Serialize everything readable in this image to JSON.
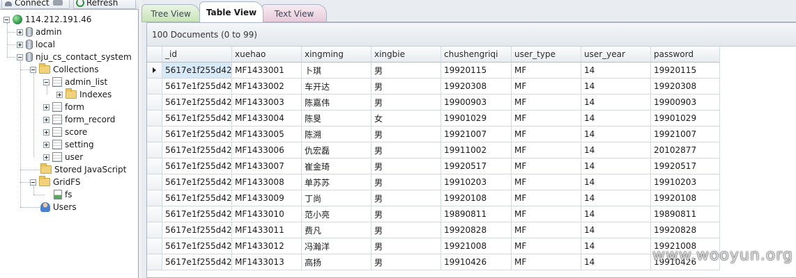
{
  "toolbar": {
    "connect_label": "Connect",
    "refresh_label": "Refresh"
  },
  "tree": {
    "server": "114.212.191.46",
    "databases": [
      "admin",
      "local",
      "nju_cs_contact_system"
    ],
    "collections_label": "Collections",
    "collections": [
      "admin_list",
      "form",
      "form_record",
      "score",
      "setting",
      "user"
    ],
    "indexes_label": "Indexes",
    "stored_js_label": "Stored JavaScript",
    "gridfs_label": "GridFS",
    "gridfs_items": [
      "fs"
    ],
    "users_label": "Users"
  },
  "tabs": [
    "Tree View",
    "Table View",
    "Text View"
  ],
  "active_tab": "Table View",
  "documents_count": "100 Documents (0 to 99)",
  "table": {
    "columns": [
      "_id",
      "xuehao",
      "xingming",
      "xingbie",
      "chushengriqi",
      "user_type",
      "user_year",
      "password"
    ],
    "rows": [
      [
        "5617e1f255d42...",
        "MF1433001",
        "卜琪",
        "男",
        "19920115",
        "MF",
        "14",
        "19920115"
      ],
      [
        "5617e1f255d42...",
        "MF1433002",
        "车开达",
        "男",
        "19920308",
        "MF",
        "14",
        "19920308"
      ],
      [
        "5617e1f255d42...",
        "MF1433003",
        "陈嘉伟",
        "男",
        "19900903",
        "MF",
        "14",
        "19900903"
      ],
      [
        "5617e1f255d42...",
        "MF1433004",
        "陈旻",
        "女",
        "19901029",
        "MF",
        "14",
        "19901029"
      ],
      [
        "5617e1f255d42...",
        "MF1433005",
        "陈溯",
        "男",
        "19921007",
        "MF",
        "14",
        "19921007"
      ],
      [
        "5617e1f255d42...",
        "MF1433006",
        "仇宏磊",
        "男",
        "19911002",
        "MF",
        "14",
        "20102877"
      ],
      [
        "5617e1f255d42...",
        "MF1433007",
        "崔金琦",
        "男",
        "19920517",
        "MF",
        "14",
        "19920517"
      ],
      [
        "5617e1f255d42...",
        "MF1433008",
        "单苏苏",
        "男",
        "19910203",
        "MF",
        "14",
        "19910203"
      ],
      [
        "5617e1f255d42...",
        "MF1433009",
        "丁尚",
        "男",
        "19920108",
        "MF",
        "14",
        "19920108"
      ],
      [
        "5617e1f255d42...",
        "MF1433010",
        "范小亮",
        "男",
        "19890811",
        "MF",
        "14",
        "19890811"
      ],
      [
        "5617e1f255d42...",
        "MF1433011",
        "费凡",
        "男",
        "19920828",
        "MF",
        "14",
        "19920828"
      ],
      [
        "5617e1f255d42...",
        "MF1433012",
        "冯瀚洋",
        "男",
        "19921008",
        "MF",
        "14",
        "19921008"
      ],
      [
        "5617e1f255d42...",
        "MF1433013",
        "高扬",
        "男",
        "19910426",
        "MF",
        "14",
        "19910426"
      ]
    ]
  },
  "watermark": "www.wooyun.org",
  "colors": {
    "selection": "#d6e9f8",
    "tab_tree": "#c8e3b7",
    "tab_text": "#e7c8d9",
    "pane_bg": "#e9edf2"
  }
}
